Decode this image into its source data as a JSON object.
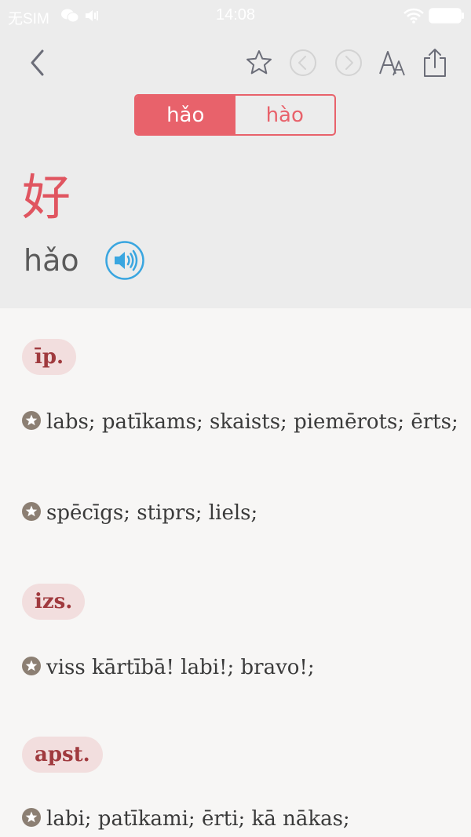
{
  "status_bar": {
    "carrier": "无SIM",
    "time": "14:08"
  },
  "toolbar": {
    "back_icon": "chevron-left-icon",
    "favorite_icon": "star-outline-icon",
    "prev_icon": "circle-chevron-left-icon",
    "next_icon": "circle-chevron-right-icon",
    "font_size_icon": "font-size-icon",
    "share_icon": "share-icon"
  },
  "reading_selector": {
    "options": [
      {
        "label": "hǎo",
        "active": true
      },
      {
        "label": "hào",
        "active": false
      }
    ]
  },
  "entry": {
    "character": "好",
    "pinyin": "hǎo",
    "audio_icon": "speaker-icon"
  },
  "sections": [
    {
      "pos": "īp.",
      "definitions": [
        "labs; patīkams; skaists; piemērots; ērts;",
        "spēcīgs; stiprs; liels;"
      ]
    },
    {
      "pos": "izs.",
      "definitions": [
        "viss kārtībā! labi!; bravo!;"
      ]
    },
    {
      "pos": "apst.",
      "definitions": [
        "labi; patīkami; ērti; kā nākas;"
      ]
    }
  ],
  "colors": {
    "accent": "#e8626b",
    "tag_bg": "#f2dede",
    "tag_text": "#a03a3e",
    "audio_blue": "#3aa6e0",
    "definition_icon": "#8c7f73"
  }
}
